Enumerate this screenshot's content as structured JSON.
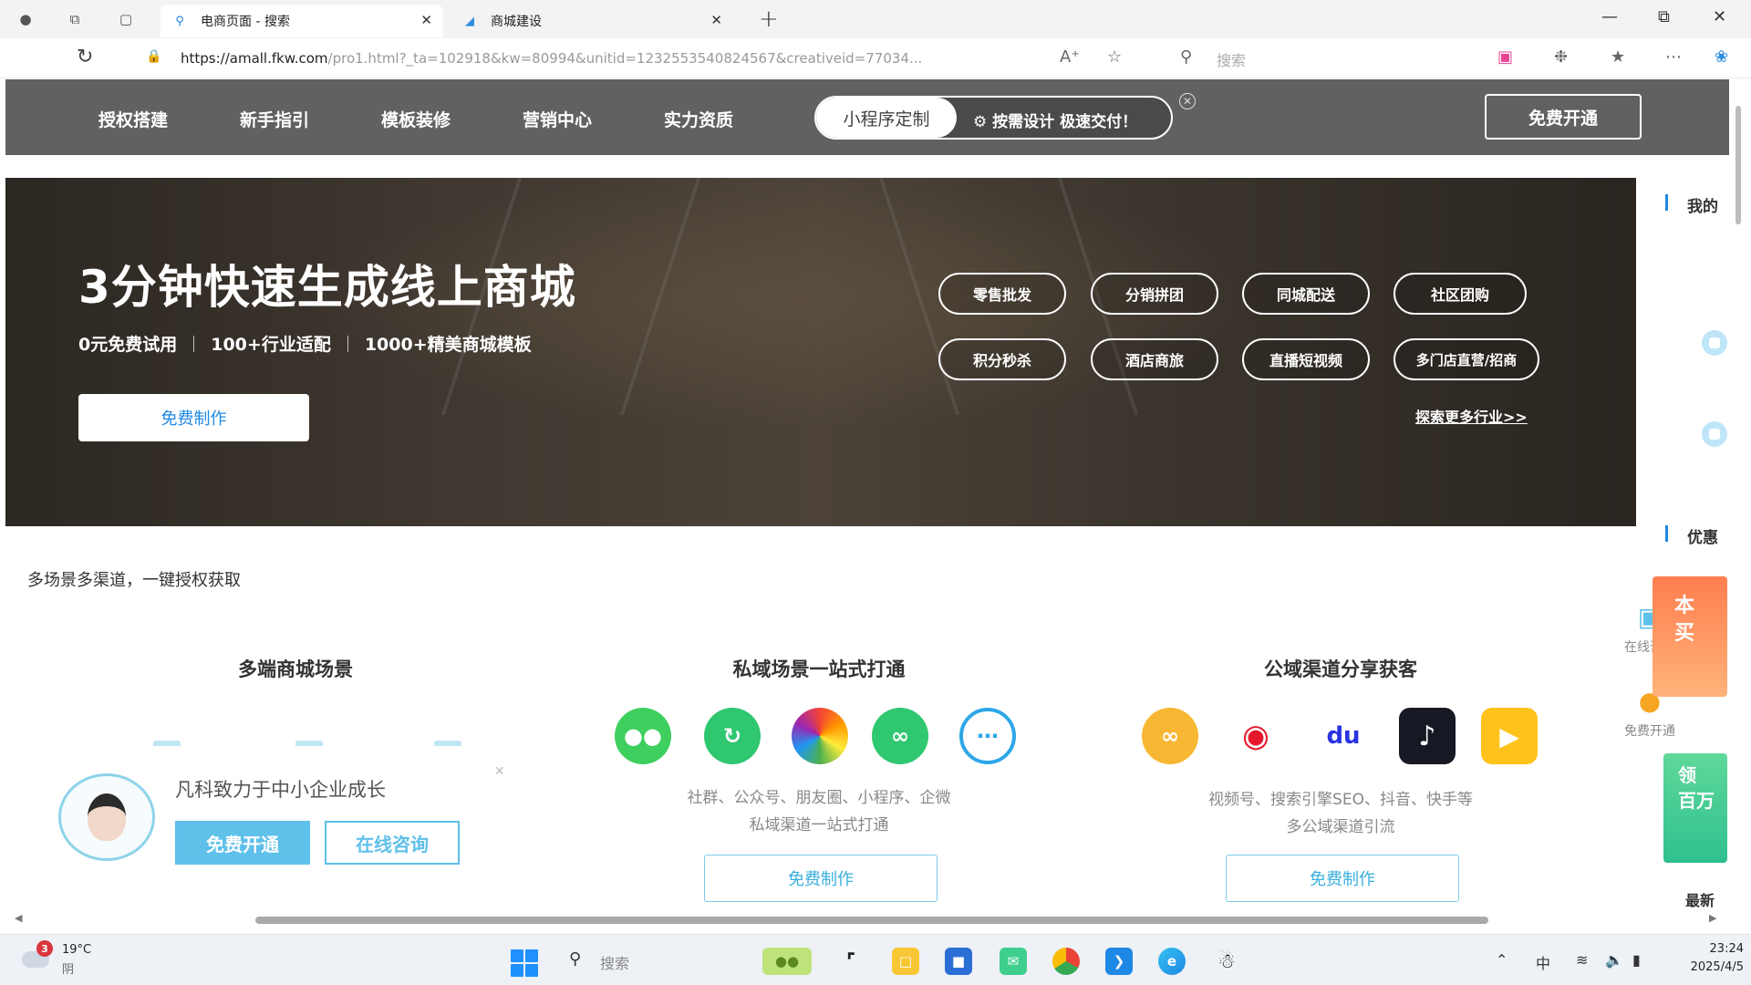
{
  "browser": {
    "tabs": [
      {
        "title": "电商页面 - 搜索",
        "favicon": "search-icon",
        "active": true
      },
      {
        "title": "商城建设",
        "favicon": "site-favicon",
        "active": false
      }
    ],
    "url_host": "https://amall.fkw.com",
    "url_path": "/pro1.html?_ta=102918&kw=80994&unitid=1232553540824567&creativeid=77034...",
    "search_placeholder": "搜索"
  },
  "nav": {
    "links": [
      "授权搭建",
      "新手指引",
      "模板装修",
      "营销中心",
      "实力资质"
    ],
    "pill_left": "小程序定制",
    "pill_right": "按需设计 极速交付！",
    "cta": "免费开通"
  },
  "hero": {
    "title": "3分钟快速生成线上商城",
    "sub": [
      "0元免费试用",
      "100+行业适配",
      "1000+精美商城模板"
    ],
    "button": "免费制作",
    "chips": [
      "零售批发",
      "分销拼团",
      "同城配送",
      "社区团购",
      "积分秒杀",
      "酒店商旅",
      "直播短视频",
      "多门店直营/招商"
    ],
    "more_link": "探索更多行业>>"
  },
  "content": {
    "section_tag": "多场景多渠道，一键授权获取",
    "columns": [
      {
        "title": "多端商城场景",
        "desc1": "",
        "desc2": "",
        "button": ""
      },
      {
        "title": "私域场景一站式打通",
        "desc1": "社群、公众号、朋友圈、小程序、企微",
        "desc2": "私域渠道一站式打通",
        "button": "免费制作"
      },
      {
        "title": "公域渠道分享获客",
        "desc1": "视频号、搜索引擎SEO、抖音、快手等",
        "desc2": "多公域渠道引流",
        "button": "免费制作"
      }
    ],
    "private_icons": [
      {
        "name": "wechat-icon",
        "color": "#3ecf5e"
      },
      {
        "name": "wechat-official-icon",
        "color": "#2fc770"
      },
      {
        "name": "moments-icon",
        "color": "#f6a623"
      },
      {
        "name": "miniprogram-icon",
        "color": "#2fc770"
      },
      {
        "name": "wecom-icon",
        "color": "#2ea7e8"
      }
    ],
    "public_icons": [
      {
        "name": "channels-icon",
        "color": "#f7b733"
      },
      {
        "name": "weibo-icon",
        "color": "#e6162d"
      },
      {
        "name": "baidu-icon",
        "color": "#2932e1"
      },
      {
        "name": "douyin-icon",
        "color": "#161823"
      },
      {
        "name": "kuaishou-icon",
        "color": "#ffc21a"
      }
    ]
  },
  "consult": {
    "title": "凡科致力于中小企业成长",
    "btn_primary": "免费开通",
    "btn_secondary": "在线咨询"
  },
  "side": {
    "label_mine": "我的",
    "label_discount": "优惠",
    "fab_consult": "在线咨询",
    "fab_open": "免费开通",
    "promo_text_1": "本",
    "promo_text_2": "买",
    "promo2_text_1": "领",
    "promo2_text_2": "百万",
    "bottom": "最新"
  },
  "taskbar": {
    "weather_badge": "3",
    "temperature": "19°C",
    "condition": "阴",
    "search": "搜索",
    "ime": "中",
    "time": "23:24",
    "date": "2025/4/5"
  }
}
